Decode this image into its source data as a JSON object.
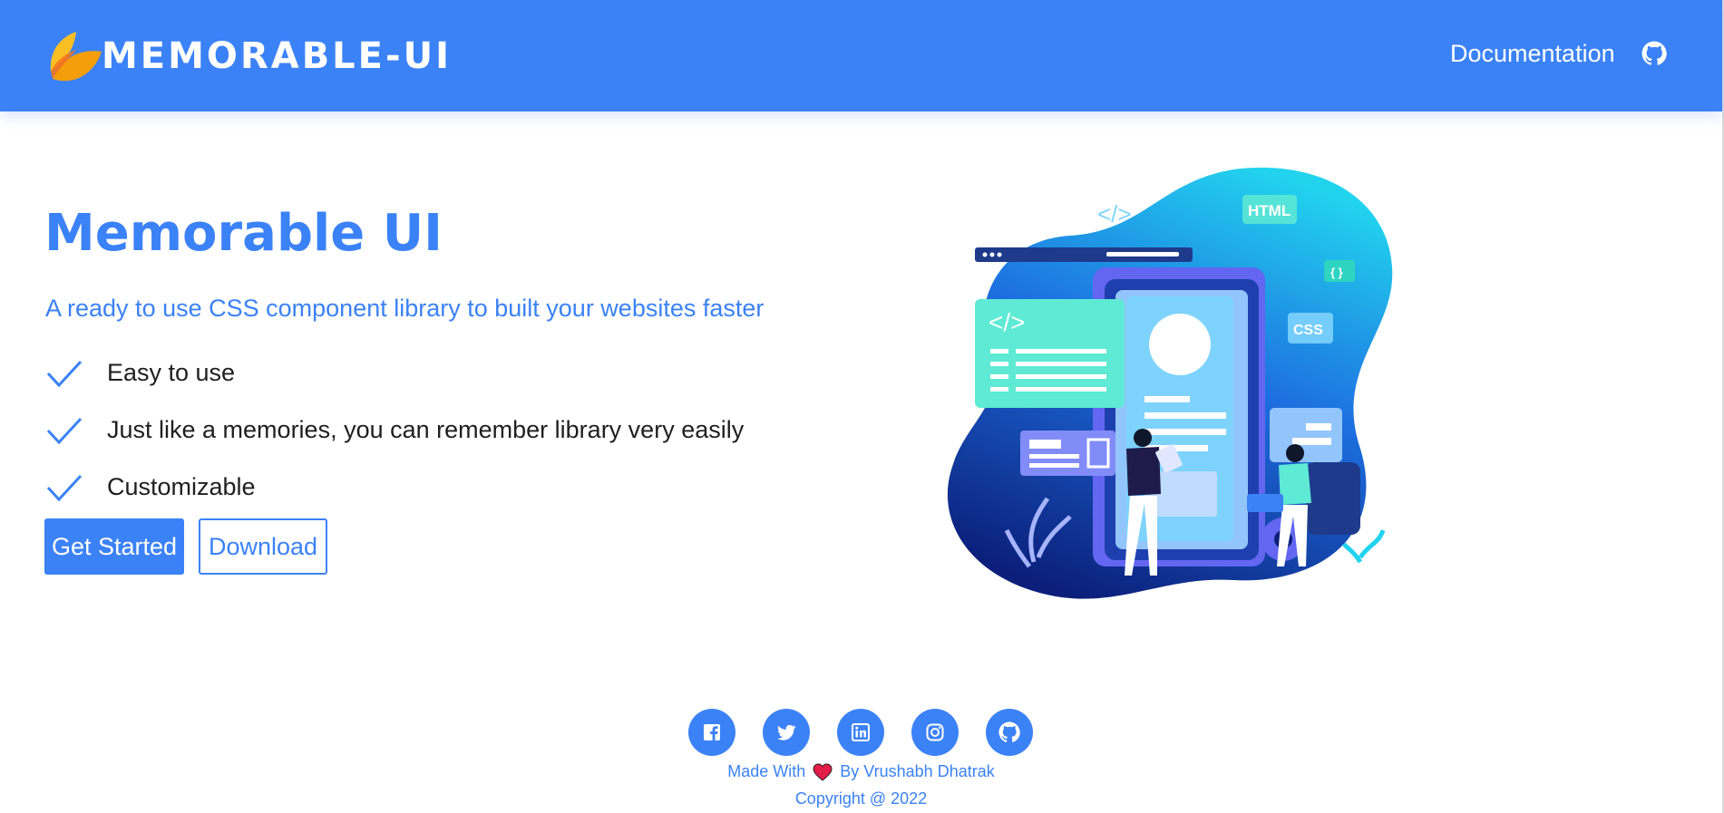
{
  "navbar": {
    "brand": "MEMORABLE-UI",
    "links": {
      "documentation": "Documentation"
    },
    "icons": {
      "logo": "leaf-logo-icon",
      "github": "github-icon"
    }
  },
  "hero": {
    "title": "Memorable UI",
    "subtitle": "A ready to use CSS component library to built your websites faster",
    "features": [
      "Easy to use",
      "Just like a memories, you can remember library very easily",
      "Customizable"
    ],
    "feature_icon": "check-icon",
    "buttons": {
      "primary": "Get Started",
      "secondary": "Download"
    },
    "illustration": {
      "code_tag": "</>",
      "html_tag": "HTML",
      "braces_tag": "{ }",
      "css_tag": "CSS"
    }
  },
  "footer": {
    "social_icons": [
      "facebook-icon",
      "twitter-icon",
      "linkedin-icon",
      "instagram-icon",
      "github-icon"
    ],
    "made_with_prefix": "Made With",
    "made_with_suffix": "By Vrushabh Dhatrak",
    "copyright": "Copyright @ 2022"
  },
  "colors": {
    "primary": "#3b82f6",
    "logo_orange": "#f59e0b",
    "text_dark": "#1f1f1f",
    "heart": "#e11d48",
    "white": "#ffffff"
  }
}
